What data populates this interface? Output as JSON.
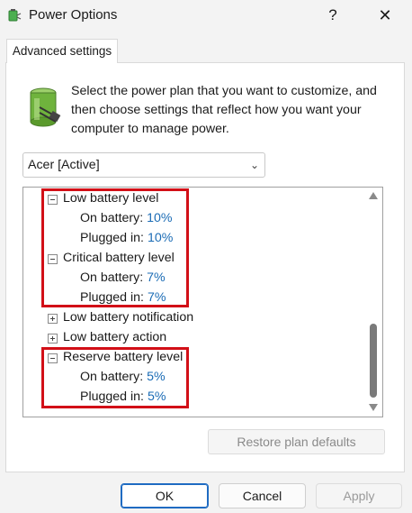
{
  "window": {
    "title": "Power Options",
    "help_label": "?",
    "close_label": "✕",
    "icon": "power-options-icon"
  },
  "tab": {
    "label": "Advanced settings"
  },
  "description": "Select the power plan that you want to customize, and then choose settings that reflect how you want your computer to manage power.",
  "plan_select": {
    "value": "Acer [Active]",
    "icon": "chevron-down-icon"
  },
  "tree": {
    "low_battery_level": {
      "label": "Low battery level",
      "on_battery_label": "On battery:",
      "on_battery_value": "10%",
      "plugged_in_label": "Plugged in:",
      "plugged_in_value": "10%"
    },
    "critical_battery_level": {
      "label": "Critical battery level",
      "on_battery_label": "On battery:",
      "on_battery_value": "7%",
      "plugged_in_label": "Plugged in:",
      "plugged_in_value": "7%"
    },
    "low_battery_notification": {
      "label": "Low battery notification"
    },
    "low_battery_action": {
      "label": "Low battery action"
    },
    "reserve_battery_level": {
      "label": "Reserve battery level",
      "on_battery_label": "On battery:",
      "on_battery_value": "5%",
      "plugged_in_label": "Plugged in:",
      "plugged_in_value": "5%"
    }
  },
  "buttons": {
    "restore": "Restore plan defaults",
    "ok": "OK",
    "cancel": "Cancel",
    "apply": "Apply"
  },
  "colors": {
    "highlight": "#d20f17",
    "value_link": "#1a6bb5",
    "ok_border": "#1f6bc2"
  }
}
